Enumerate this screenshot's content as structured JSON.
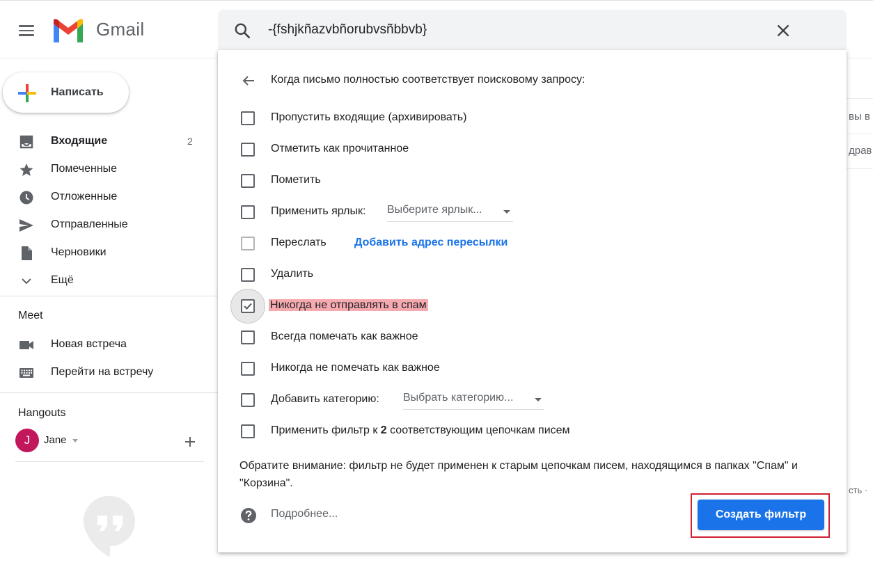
{
  "header": {
    "brand": "Gmail",
    "search_value": "-{fshjkñazvbñorubvsñbbvb}"
  },
  "sidebar": {
    "compose_label": "Написать",
    "items": [
      {
        "label": "Входящие",
        "count": "2",
        "icon": "inbox-icon"
      },
      {
        "label": "Помеченные",
        "icon": "star-icon"
      },
      {
        "label": "Отложенные",
        "icon": "clock-icon"
      },
      {
        "label": "Отправленные",
        "icon": "send-icon"
      },
      {
        "label": "Черновики",
        "icon": "draft-icon"
      },
      {
        "label": "Ещё",
        "icon": "chevron-down-icon"
      }
    ],
    "meet": {
      "title": "Meet",
      "items": [
        {
          "label": "Новая встреча",
          "icon": "videocam-icon"
        },
        {
          "label": "Перейти на встречу",
          "icon": "keyboard-icon"
        }
      ]
    },
    "hangouts": {
      "title": "Hangouts",
      "user_initial": "J",
      "user_name": "Jane"
    }
  },
  "background": {
    "snippet_1": "вы в",
    "snippet_2": "драв",
    "snippet_3": "сть ·"
  },
  "filter_dialog": {
    "heading": "Когда письмо полностью соответствует поисковому запросу:",
    "options": [
      {
        "label": "Пропустить входящие (архивировать)",
        "checked": false
      },
      {
        "label": "Отметить как прочитанное",
        "checked": false
      },
      {
        "label": "Пометить",
        "checked": false
      },
      {
        "label": "Применить ярлык:",
        "checked": false,
        "select_value": "Выберите ярлык..."
      },
      {
        "label": "Переслать",
        "checked": false,
        "link": "Добавить адрес пересылки"
      },
      {
        "label": "Удалить",
        "checked": false
      },
      {
        "label": "Никогда не отправлять в спам",
        "checked": true
      },
      {
        "label": "Всегда помечать как важное",
        "checked": false
      },
      {
        "label": "Никогда не помечать как важное",
        "checked": false
      },
      {
        "label": "Добавить категорию:",
        "checked": false,
        "select_value": "Выбрать категорию..."
      },
      {
        "label_prefix": "Применить фильтр к ",
        "label_count": "2",
        "label_suffix": " соответствующим цепочкам писем",
        "checked": false
      }
    ],
    "note": "Обратите внимание: фильтр не будет применен к старым цепочкам писем, находящимся в папках \"Спам\" и \"Корзина\".",
    "help_label": "Подробнее...",
    "create_button": "Создать фильтр"
  },
  "colors": {
    "accent": "#1a73e8",
    "highlight": "#f6aab0",
    "outline": "#d01f2f",
    "avatar": "#c2185b"
  }
}
